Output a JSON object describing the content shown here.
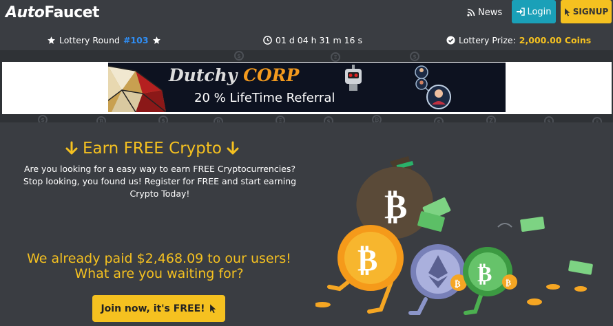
{
  "navbar": {
    "brand_prefix": "Auto",
    "brand_suffix": "Faucet",
    "news_label": "News",
    "login_label": "Login",
    "signup_label": "SIGNUP"
  },
  "lottery": {
    "round_label": "Lottery Round",
    "round_number": "#103",
    "timer": "01 d 04 h 31 m 16 s",
    "prize_label": "Lottery Prize:",
    "prize_value": "2,000.00 Coins"
  },
  "banner": {
    "title_part1": "Dutchy",
    "title_part2": "CORP",
    "subtitle": "20 % LifeTime Referral"
  },
  "hero": {
    "title": "Earn FREE Crypto",
    "description": "Are you looking for a easy way to earn FREE Cryptocurrencies? Stop looking, you found us! Register for FREE and start earning Crypto Today!",
    "paid_line1": "We already paid $2,468.09 to our users!",
    "paid_line2": "What are you waiting for?",
    "join_label": "Join now, it's FREE!"
  },
  "colors": {
    "accent_yellow": "#f5c120",
    "login_teal": "#1aa0b8",
    "round_blue": "#2f8ef5",
    "background": "#3a3d42"
  },
  "icons": [
    "rss-icon",
    "sign-in-icon",
    "cursor-icon",
    "star-icon",
    "clock-icon",
    "check-circle-icon",
    "arrow-down-icon"
  ]
}
